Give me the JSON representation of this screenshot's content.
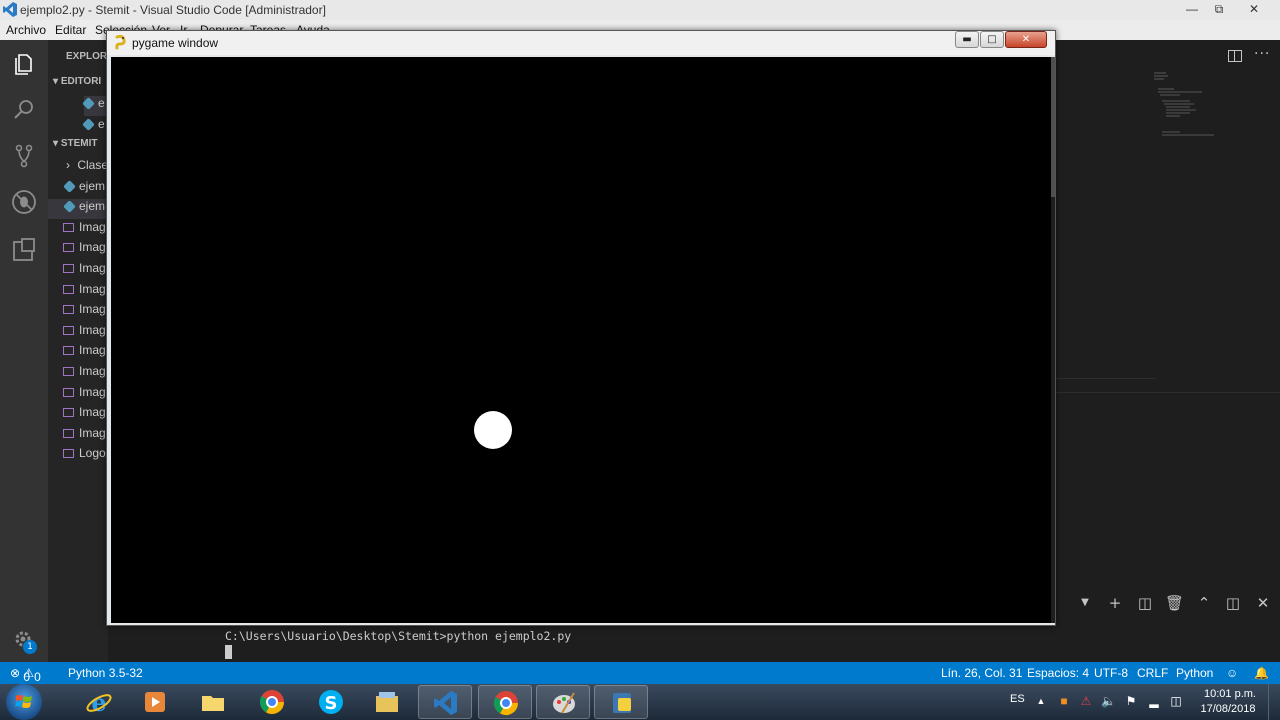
{
  "vscode": {
    "title": "ejemplo2.py - Stemit - Visual Studio Code [Administrador]",
    "window_controls": [
      "minimize-button",
      "maximize-button",
      "close-button"
    ],
    "menu": [
      "Archivo",
      "Editar",
      "Selección",
      "Ver",
      "Ir",
      "Depurar",
      "Tareas",
      "Ayuda"
    ],
    "sidebar": {
      "explorer_header": "EXPLORA",
      "editors_header": "EDITORI",
      "open_editors": [
        "e",
        "e"
      ],
      "folder_header": "STEMIT",
      "items": [
        {
          "label": "Clase",
          "kind": "folder"
        },
        {
          "label": "ejem",
          "kind": "python"
        },
        {
          "label": "ejem",
          "kind": "python"
        },
        {
          "label": "Imag",
          "kind": "image"
        },
        {
          "label": "Imag",
          "kind": "image"
        },
        {
          "label": "Imag",
          "kind": "image"
        },
        {
          "label": "Imag",
          "kind": "image"
        },
        {
          "label": "Imag",
          "kind": "image"
        },
        {
          "label": "Imag",
          "kind": "image"
        },
        {
          "label": "Imag",
          "kind": "image"
        },
        {
          "label": "Imag",
          "kind": "image"
        },
        {
          "label": "Imag",
          "kind": "image"
        },
        {
          "label": "Imag",
          "kind": "image"
        },
        {
          "label": "Imag",
          "kind": "image"
        },
        {
          "label": "Logo",
          "kind": "image"
        }
      ]
    },
    "terminal": {
      "command": "C:\\Users\\Usuario\\Desktop\\Stemit>python ejemplo2.py"
    },
    "statusbar": {
      "errors": "0",
      "warnings": "0",
      "interpreter": "Python 3.5-32",
      "position": "Lín. 26, Col. 31",
      "spaces": "Espacios: 4",
      "encoding": "UTF-8",
      "eol": "CRLF",
      "language": "Python"
    },
    "settings_badge": "1"
  },
  "pygame": {
    "title": "pygame window",
    "ball_color": "#ffffff",
    "background_color": "#000000"
  },
  "taskbar": {
    "apps": [
      "internet-explorer",
      "media-player",
      "file-manager",
      "chrome",
      "skype",
      "explorer",
      "vscode",
      "chrome-alt",
      "paint",
      "python"
    ],
    "tray": {
      "language": "ES",
      "time": "10:01 p.m.",
      "date": "17/08/2018"
    }
  },
  "colors": {
    "accent": "#007acc",
    "sidebar_bg": "#252526",
    "editor_bg": "#1e1e1e",
    "activity_bg": "#333333"
  }
}
